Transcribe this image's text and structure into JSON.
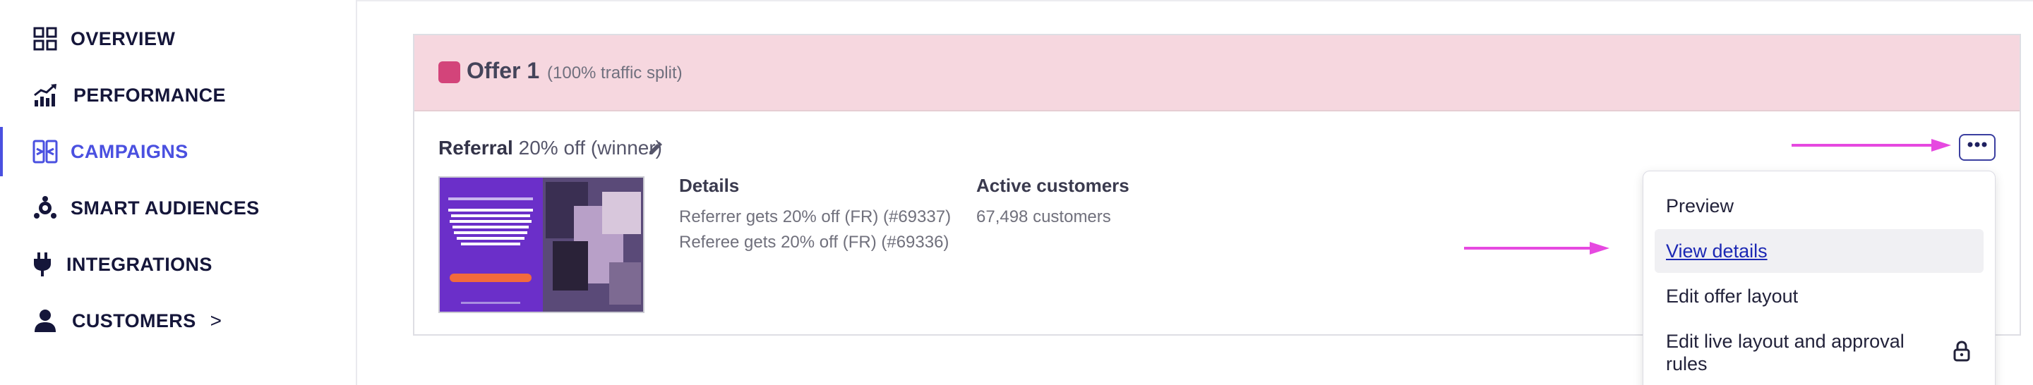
{
  "sidebar": {
    "items": [
      {
        "label": "OVERVIEW",
        "icon": "grid-icon"
      },
      {
        "label": "PERFORMANCE",
        "icon": "chart-trend-icon"
      },
      {
        "label": "CAMPAIGNS",
        "icon": "campaigns-icon",
        "active": true
      },
      {
        "label": "SMART AUDIENCES",
        "icon": "audience-icon"
      },
      {
        "label": "INTEGRATIONS",
        "icon": "plug-icon"
      },
      {
        "label": "CUSTOMERS",
        "icon": "person-icon",
        "chevron": ">"
      }
    ]
  },
  "offer": {
    "title": "Offer 1",
    "split": "(100% traffic split)",
    "color": "#d3447a"
  },
  "referral": {
    "name": "Referral",
    "subtitle": "20% off (winner)"
  },
  "details": {
    "heading": "Details",
    "lines": [
      "Referrer gets 20% off (FR) (#69337)",
      "Referee gets 20% off (FR) (#69336)"
    ]
  },
  "active_customers": {
    "heading": "Active customers",
    "value": "67,498 customers"
  },
  "menu": {
    "items": [
      "Preview",
      "View details",
      "Edit offer layout",
      "Edit live layout and approval",
      "rules"
    ]
  },
  "colors": {
    "accent": "#4a50e0",
    "arrow": "#e649e0",
    "offer_header_bg": "#f6d7df"
  }
}
